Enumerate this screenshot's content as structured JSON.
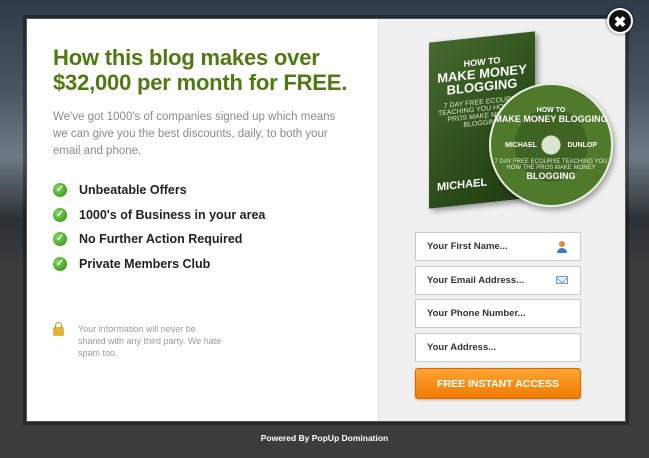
{
  "headline": "How this blog makes over $32,000 per month for FREE.",
  "subtext": "We've got 1000's of companies signed up which means we can give you the best discounts, daily, to both your email and phone.",
  "features": [
    "Unbeatable Offers",
    "1000's of Business in your area",
    "No Further Action Required",
    "Private Members Club"
  ],
  "privacy_text": "Your information will never be shared with any third party. We hate spam too.",
  "product": {
    "box_title_small": "HOW TO",
    "box_title_main": "MAKE MONEY BLOGGING",
    "box_tagline": "7 DAY FREE ECOURSE TEACHING YOU HOW THE PROS MAKE MONEY BLOGGING",
    "box_author": "MICHAEL",
    "disc_title_small": "HOW TO",
    "disc_title_main": "MAKE MONEY BLOGGING",
    "disc_author_first": "MICHAEL",
    "disc_author_last": "DUNLOP",
    "disc_tagline": "7 DAY FREE ECOURSE TEACHING YOU HOW THE PROS MAKE MONEY",
    "disc_bottom": "BLOGGING"
  },
  "form": {
    "first_name_placeholder": "Your First Name...",
    "email_placeholder": "Your Email Address...",
    "phone_placeholder": "Your Phone Number...",
    "address_placeholder": "Your Address...",
    "submit_label": "FREE INSTANT ACCESS"
  },
  "close_label": "✖",
  "powered_by": "Powered By PopUp Domination",
  "colors": {
    "headline_green": "#4f7a12",
    "button_orange": "#f08a1c",
    "check_green": "#3fa81e"
  }
}
